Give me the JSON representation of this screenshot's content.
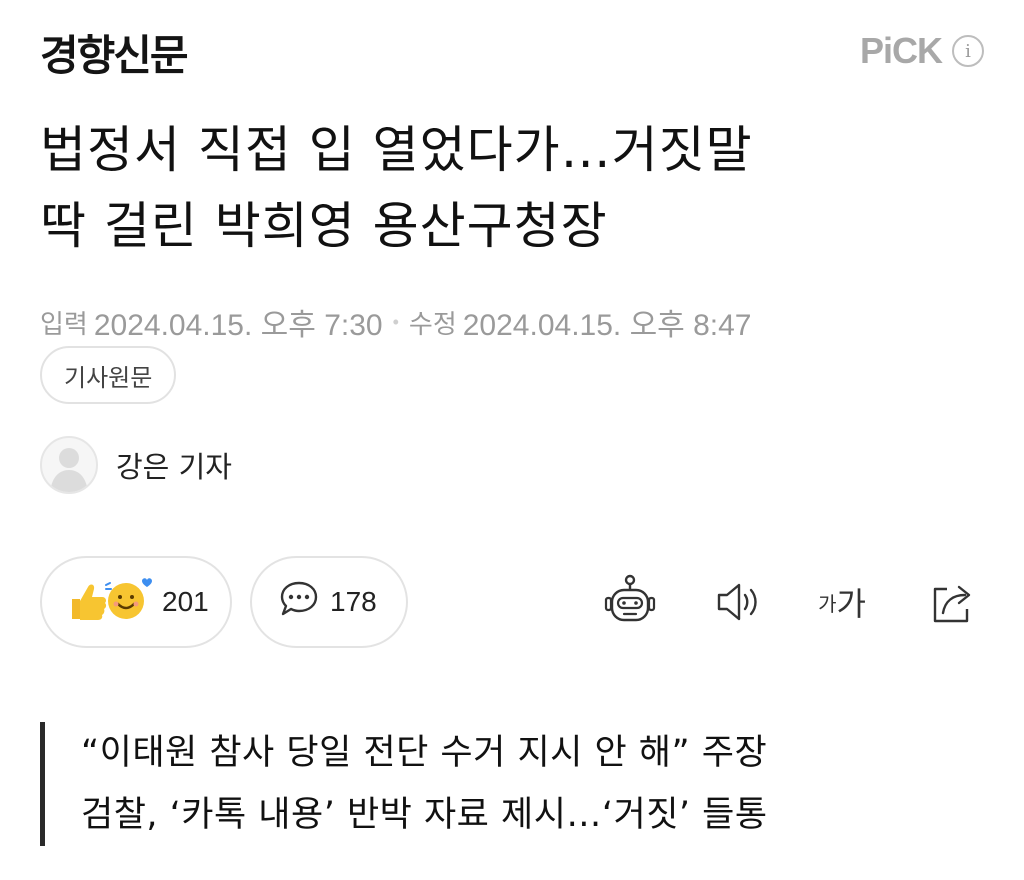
{
  "header": {
    "press_name": "경향신문",
    "pick_label": "PiCK",
    "info_icon": "info-icon"
  },
  "article": {
    "title_line1": "법정서 직접 입 열었다가…거짓말",
    "title_line2": "딱 걸린 박희영 용산구청장",
    "input_label": "입력",
    "input_date": "2024.04.15. 오후 7:30",
    "modified_label": "수정",
    "modified_date": "2024.04.15. 오후 8:47",
    "source_button": "기사원문",
    "reporter": "강은 기자",
    "subheading_line1": "“이태원 참사 당일 전단 수거 지시 안 해” 주장",
    "subheading_line2": "검찰, ‘카톡 내용’ 반박 자료 제시…‘거짓’ 들통"
  },
  "actions": {
    "reaction_count": "201",
    "comment_count": "178",
    "font_size_small": "가",
    "font_size_big": "가"
  },
  "colors": {
    "text": "#111111",
    "muted": "#9a9a9a",
    "border": "#e3e3e3",
    "emoji_yellow": "#f7c531",
    "emoji_heart": "#3d8ef0"
  }
}
